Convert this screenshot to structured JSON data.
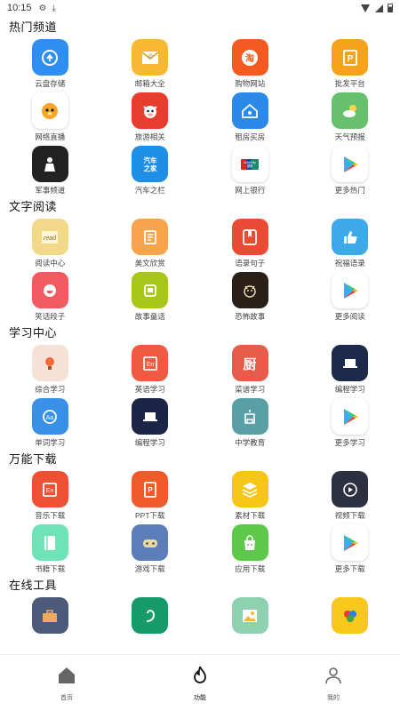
{
  "status": {
    "time": "10:15"
  },
  "sections": [
    {
      "title": "热门频道",
      "tiles": [
        {
          "label": "云盘存储",
          "icon": "cloud-sync-icon",
          "color": "#2f8ff0"
        },
        {
          "label": "邮箱大全",
          "icon": "mail-icon",
          "color": "#f7b733"
        },
        {
          "label": "购物网站",
          "icon": "taobao-icon",
          "color": "#f25a1f"
        },
        {
          "label": "批发平台",
          "icon": "p-badge-icon",
          "color": "#f7a21b"
        },
        {
          "label": "网络直播",
          "icon": "live-mascot-icon",
          "color": "#ffffff"
        },
        {
          "label": "旅游相关",
          "icon": "cow-icon",
          "color": "#e63d2e"
        },
        {
          "label": "租房买房",
          "icon": "house-icon",
          "color": "#2b8ae8"
        },
        {
          "label": "天气预报",
          "icon": "weather-icon",
          "color": "#67c06b"
        },
        {
          "label": "军事频道",
          "icon": "soldier-icon",
          "color": "#222222"
        },
        {
          "label": "汽车之栏",
          "icon": "car-text-icon",
          "color": "#1f8ee5"
        },
        {
          "label": "网上银行",
          "icon": "unionpay-icon",
          "color": "#ffffff"
        },
        {
          "label": "更多热门",
          "icon": "play-store-icon",
          "color": "#ffffff"
        }
      ]
    },
    {
      "title": "文字阅读",
      "tiles": [
        {
          "label": "阅读中心",
          "icon": "read-notebook-icon",
          "color": "#f2d98a"
        },
        {
          "label": "美文欣赏",
          "icon": "article-icon",
          "color": "#f7a44c"
        },
        {
          "label": "语录句子",
          "icon": "bookmark-icon",
          "color": "#ea4b35"
        },
        {
          "label": "祝福语录",
          "icon": "thumb-up-icon",
          "color": "#3da9e8"
        },
        {
          "label": "笑话段子",
          "icon": "smile-icon",
          "color": "#f15a60"
        },
        {
          "label": "故事童话",
          "icon": "story-icon",
          "color": "#a9c61a"
        },
        {
          "label": "恐怖故事",
          "icon": "devil-icon",
          "color": "#2a201a"
        },
        {
          "label": "更多阅读",
          "icon": "play-store-icon",
          "color": "#ffffff"
        }
      ]
    },
    {
      "title": "学习中心",
      "tiles": [
        {
          "label": "综合学习",
          "icon": "bulb-icon",
          "color": "#f6e1d6"
        },
        {
          "label": "英语学习",
          "icon": "en-card-icon",
          "color": "#f05a40"
        },
        {
          "label": "菜谱学习",
          "icon": "kitchen-icon",
          "color": "#e85a4a"
        },
        {
          "label": "编程学习",
          "icon": "laptop-icon",
          "color": "#1d2a4a"
        },
        {
          "label": "单词学习",
          "icon": "word-icon",
          "color": "#3a8fe6"
        },
        {
          "label": "编程学习",
          "icon": "laptop-icon",
          "color": "#1b2545"
        },
        {
          "label": "中学教育",
          "icon": "school-icon",
          "color": "#5a9fa5"
        },
        {
          "label": "更多学习",
          "icon": "play-store-icon",
          "color": "#ffffff"
        }
      ]
    },
    {
      "title": "万能下载",
      "tiles": [
        {
          "label": "音乐下载",
          "icon": "music-download-icon",
          "color": "#ee5033"
        },
        {
          "label": "PPT下载",
          "icon": "ppt-icon",
          "color": "#ee5a2a"
        },
        {
          "label": "素材下载",
          "icon": "layers-icon",
          "color": "#f5c518"
        },
        {
          "label": "视频下载",
          "icon": "video-download-icon",
          "color": "#2d3040"
        },
        {
          "label": "书籍下载",
          "icon": "book-icon",
          "color": "#6fe3b8"
        },
        {
          "label": "游戏下载",
          "icon": "gamepad-icon",
          "color": "#5b7db8"
        },
        {
          "label": "应用下载",
          "icon": "android-bag-icon",
          "color": "#5cc94a"
        },
        {
          "label": "更多下载",
          "icon": "play-store-icon",
          "color": "#ffffff"
        }
      ]
    },
    {
      "title": "在线工具",
      "tiles": [
        {
          "label": "",
          "icon": "toolbox-icon",
          "color": "#4a5a78"
        },
        {
          "label": "",
          "icon": "swirl-icon",
          "color": "#169a6a"
        },
        {
          "label": "",
          "icon": "picture-icon",
          "color": "#8ed1b0"
        },
        {
          "label": "",
          "icon": "colorful-icon",
          "color": "#f7c71b"
        }
      ]
    }
  ],
  "bottom_nav": [
    {
      "label": "首页",
      "icon": "home-icon"
    },
    {
      "label": "功能",
      "icon": "flame-icon",
      "active": true
    },
    {
      "label": "我的",
      "icon": "user-icon"
    }
  ]
}
